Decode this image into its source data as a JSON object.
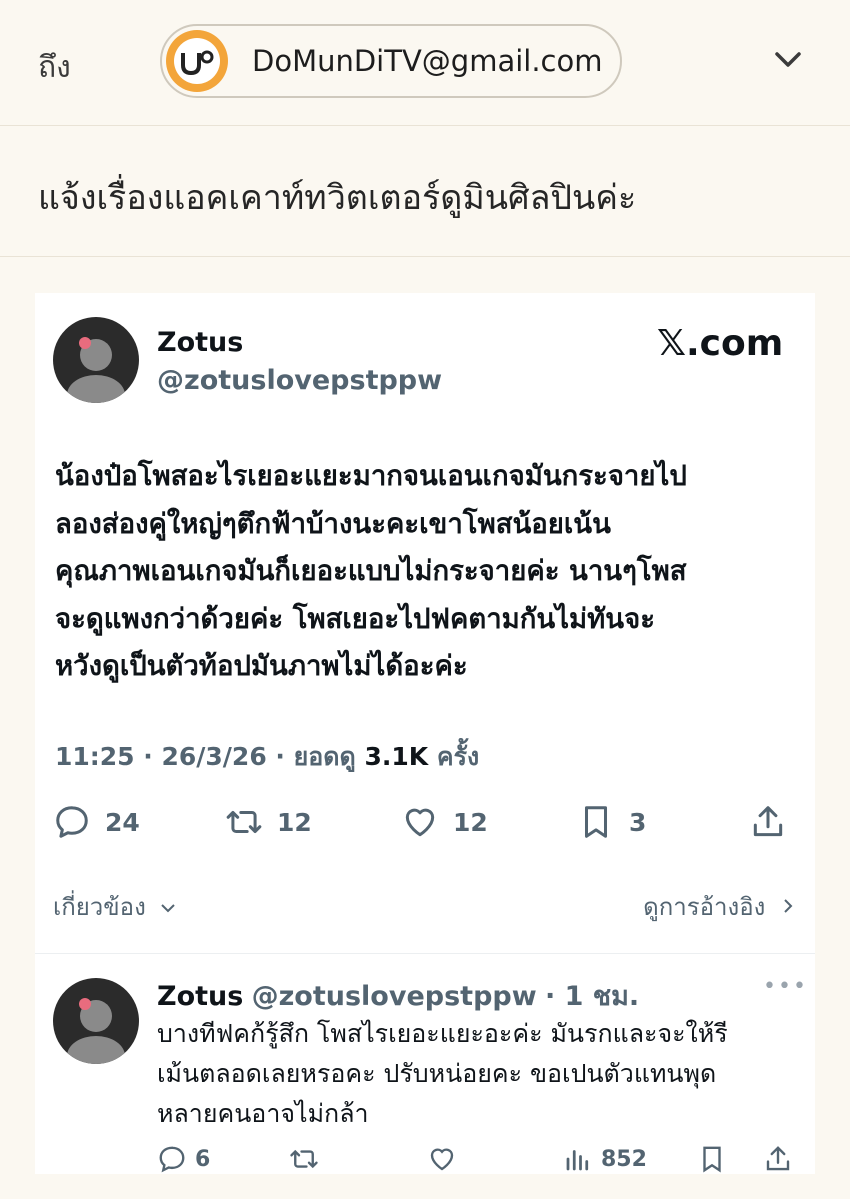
{
  "header": {
    "to_label": "ถึง",
    "recipient_email": "DoMunDiTV@gmail.com",
    "avatar_icon": "domundi-logo-icon"
  },
  "email": {
    "subject": "แจ้งเรื่องแอคเคาท์ทวิตเตอร์ดูมินศิลปินค่ะ"
  },
  "tweet": {
    "author_name": "Zotus",
    "author_handle": "@zotuslovepstppw",
    "source": "𝕏.com",
    "text_lines": [
      "น้องป๋อโพสอะไรเยอะแยะมากจนเอนเกจมันกระจายไป",
      "ลองส่องคู่ใหญ่ๆตึกฟ้าบ้างนะคะเขาโพสน้อยเน้น",
      "คุณภาพเอนเกจมันก็เยอะแบบไม่กระจายค่ะ นานๆโพส",
      "จะดูแพงกว่าด้วยค่ะ โพสเยอะไปฟคตามกันไม่ทันจะ",
      "หวังดูเป็นตัวท้อปมันภาพไม่ได้อะค่ะ"
    ],
    "time": "11:25 · 26/3/26 · ยอดดู ",
    "views": "3.1K",
    "views_suffix": " ครั้ง",
    "replies": "24",
    "retweets": "12",
    "likes": "12",
    "bookmarks": "3",
    "related_label": "เกี่ยวข้อง",
    "quotes_label": "ดูการอ้างอิง"
  },
  "reply": {
    "author_name": "Zotus",
    "author_handle": "@zotuslovepstppw",
    "time_ago": "· 1 ชม.",
    "text_lines": [
      "บางทีฟคก้รู้สึก โพสไรเยอะแยะอะค่ะ มันรกและจะให้รี",
      "เม้นตลอดเลยหรอคะ ปรับหน่อยคะ ขอเปนตัวแทนพุด",
      "หลายคนอาจไม่กล้า"
    ],
    "replies": "6",
    "views": "852"
  },
  "colors": {
    "background": "#fbf8f1",
    "chip_avatar": "#f3a53a",
    "secondary_text": "#536471"
  }
}
